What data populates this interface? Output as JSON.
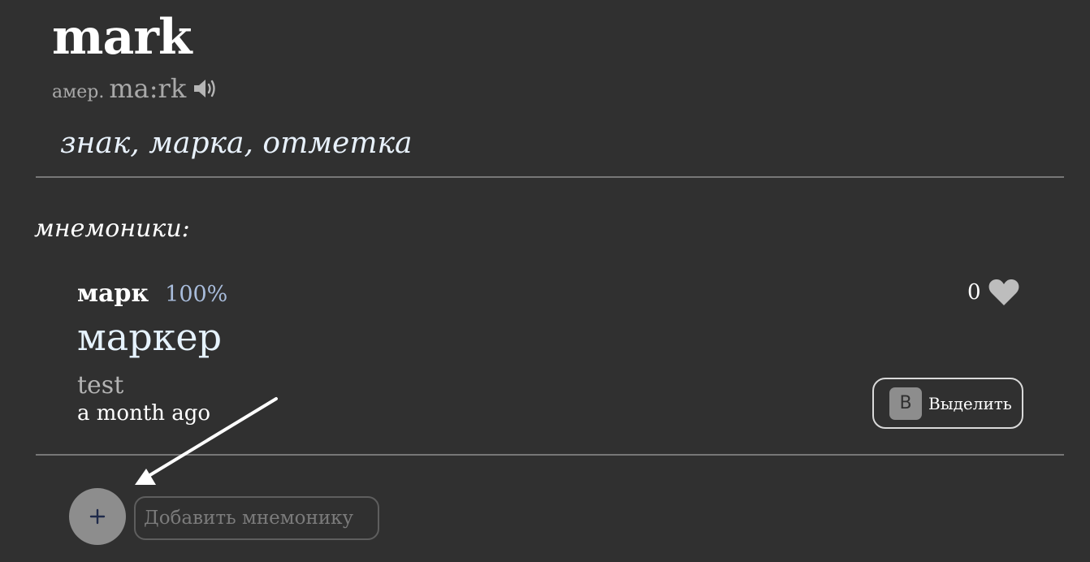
{
  "word": {
    "title": "mark",
    "pronunciation_label": "амер.",
    "pronunciation": "ma:rk",
    "speaker_icon": "speaker-icon",
    "translation": "знак, марка, отметка"
  },
  "mnemonics": {
    "section_label": "мнемоники:",
    "items": [
      {
        "word": "марк",
        "match_percent": "100%",
        "phrase": "маркер",
        "note": "test",
        "time": "a month ago",
        "likes": "0",
        "like_icon": "heart-icon",
        "highlight_key": "B",
        "highlight_label": "Выделить"
      }
    ]
  },
  "add_mnemonic": {
    "button_icon": "plus-icon",
    "placeholder": "Добавить мнемонику",
    "value": ""
  },
  "colors": {
    "background": "#303030",
    "accent_percent": "#a8bcdb",
    "button_gray": "#8d8d8d"
  }
}
